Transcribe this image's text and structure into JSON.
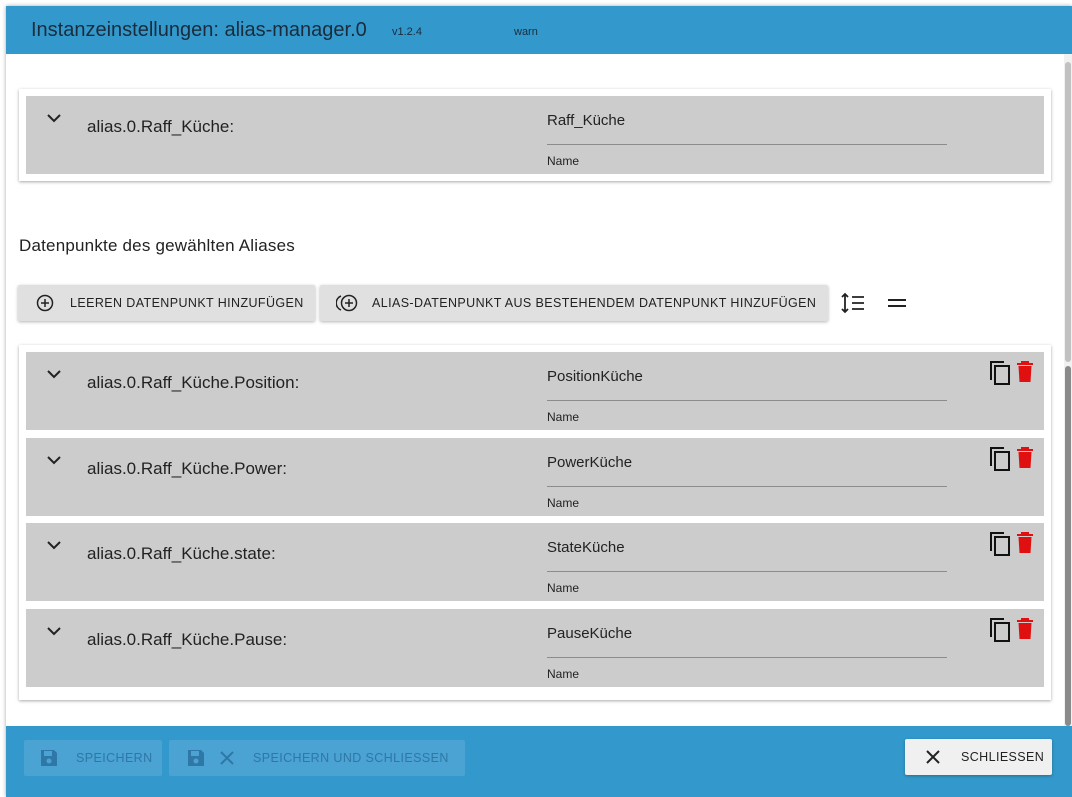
{
  "header": {
    "title": "Instanzeinstellungen: alias-manager.0",
    "version": "v1.2.4",
    "log_level": "warn"
  },
  "alias": {
    "label": "alias.0.Raff_Küche:",
    "name_value": "Raff_Küche",
    "name_caption": "Name"
  },
  "section": {
    "title": "Datenpunkte des gewählten Aliases"
  },
  "toolbar": {
    "add_empty_label": "LEEREN DATENPUNKT HINZUFÜGEN",
    "add_existing_label": "ALIAS-DATENPUNKT AUS BESTEHENDEM DATENPUNKT HINZUFÜGEN"
  },
  "datapoints": [
    {
      "label": "alias.0.Raff_Küche.Position:",
      "name_value": "PositionKüche",
      "name_caption": "Name"
    },
    {
      "label": "alias.0.Raff_Küche.Power:",
      "name_value": "PowerKüche",
      "name_caption": "Name"
    },
    {
      "label": "alias.0.Raff_Küche.state:",
      "name_value": "StateKüche",
      "name_caption": "Name"
    },
    {
      "label": "alias.0.Raff_Küche.Pause:",
      "name_value": "PauseKüche",
      "name_caption": "Name"
    }
  ],
  "footer": {
    "save_label": "SPEICHERN",
    "save_close_label": "SPEICHERN UND SCHLIESSEN",
    "close_label": "SCHLIESSEN"
  },
  "colors": {
    "header_bg": "#3399cc",
    "row_bg": "#cccccc",
    "delete_icon": "#e01010",
    "footer_bg": "#3399cc"
  },
  "icons": {
    "chevron": "chevron-down-icon",
    "add": "add-circle-icon",
    "add_existing": "add-circle-outline-icon",
    "sort": "sort-lines-icon",
    "collapse": "equals-icon",
    "copy": "copy-icon",
    "delete": "trash-icon",
    "save": "floppy-icon",
    "close": "close-icon"
  }
}
